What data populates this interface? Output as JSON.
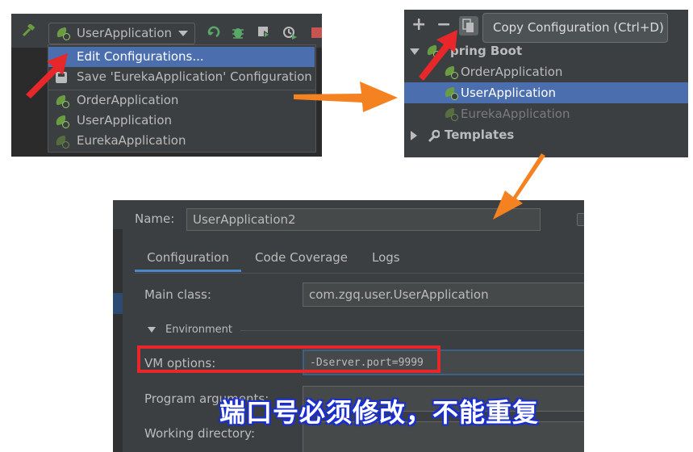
{
  "panel1": {
    "run_config_selected": "UserApplication",
    "menu_items": [
      {
        "label": "Edit Configurations...",
        "icon": "none",
        "highlighted": true
      },
      {
        "label": "Save 'EurekaApplication' Configuration",
        "icon": "save-icon"
      },
      {
        "label": "OrderApplication",
        "icon": "spring-boot-icon"
      },
      {
        "label": "UserApplication",
        "icon": "spring-boot-icon"
      },
      {
        "label": "EurekaApplication",
        "icon": "spring-boot-icon-dim"
      }
    ]
  },
  "panel2": {
    "toolbar": {
      "add": "+",
      "remove": "−"
    },
    "tooltip": "Copy Configuration (Ctrl+D)",
    "tree": {
      "group": "pring Boot",
      "items": [
        "OrderApplication",
        "UserApplication",
        "EurekaApplication"
      ],
      "templates": "Templates"
    }
  },
  "panel3": {
    "name_label": "Name:",
    "name_value": "UserApplication2",
    "tabs": [
      "Configuration",
      "Code Coverage",
      "Logs"
    ],
    "main_class_label": "Main class:",
    "main_class_value": "com.zgq.user.UserApplication",
    "environment_label": "Environment",
    "vm_options_label": "VM options:",
    "vm_options_value": "-Dserver.port=9999",
    "program_args_label": "Program arguments:",
    "working_dir_label": "Working directory:",
    "caption": "端口号必须修改，不能重复"
  },
  "colors": {
    "highlight": "#4b6eaf",
    "annotation_red": "#e8272a",
    "arrow_orange": "#f58220",
    "caption_text": "#ffffff"
  }
}
